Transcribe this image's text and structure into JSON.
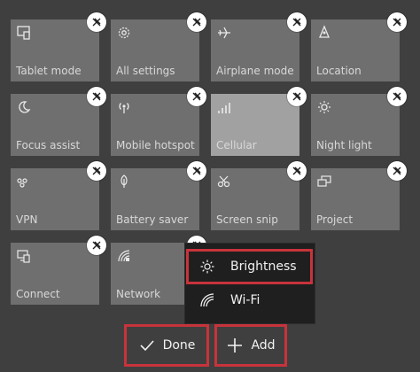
{
  "tiles": [
    {
      "label": "Tablet mode",
      "icon": "tablet-mode-icon"
    },
    {
      "label": "All settings",
      "icon": "gear-icon"
    },
    {
      "label": "Airplane mode",
      "icon": "airplane-icon"
    },
    {
      "label": "Location",
      "icon": "location-icon"
    },
    {
      "label": "Focus assist",
      "icon": "moon-icon"
    },
    {
      "label": "Mobile hotspot",
      "icon": "hotspot-icon"
    },
    {
      "label": "Cellular",
      "icon": "cellular-signal-icon"
    },
    {
      "label": "Night light",
      "icon": "sun-icon"
    },
    {
      "label": "VPN",
      "icon": "vpn-icon"
    },
    {
      "label": "Battery saver",
      "icon": "battery-saver-icon"
    },
    {
      "label": "Screen snip",
      "icon": "screen-snip-icon"
    },
    {
      "label": "Project",
      "icon": "project-icon"
    },
    {
      "label": "Connect",
      "icon": "connect-icon"
    },
    {
      "label": "Network",
      "icon": "network-icon"
    }
  ],
  "add_menu": {
    "items": [
      {
        "label": "Brightness",
        "icon": "brightness-icon"
      },
      {
        "label": "Wi-Fi",
        "icon": "wifi-icon"
      }
    ]
  },
  "buttons": {
    "done_label": "Done",
    "add_label": "Add"
  },
  "colors": {
    "tile": "#6f6f6f",
    "tile_highlight": "#a1a1a1",
    "background": "#3f3f3f",
    "menu_background": "#1f1f1f",
    "annotation_red": "#c8333b"
  }
}
